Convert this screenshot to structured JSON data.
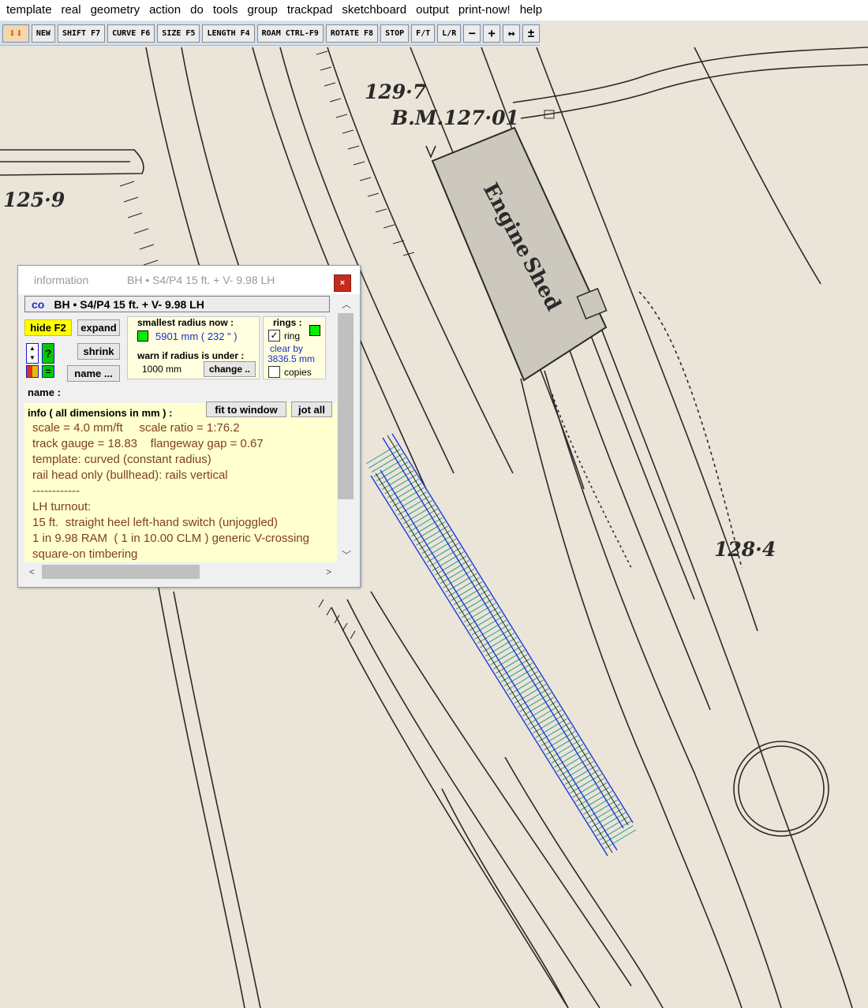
{
  "menu": {
    "items": [
      {
        "label": "template",
        "name": "menu-template"
      },
      {
        "label": "real",
        "name": "menu-real"
      },
      {
        "label": "geometry",
        "name": "menu-geometry"
      },
      {
        "label": "action",
        "name": "menu-action"
      },
      {
        "label": "do",
        "name": "menu-do"
      },
      {
        "label": "tools",
        "name": "menu-tools"
      },
      {
        "label": "group",
        "name": "menu-group"
      },
      {
        "label": "trackpad",
        "name": "menu-trackpad"
      },
      {
        "label": "sketchboard",
        "name": "menu-sketchboard"
      },
      {
        "label": "output",
        "name": "menu-output"
      },
      {
        "label": "print-now!",
        "name": "menu-print-now"
      },
      {
        "label": "help",
        "name": "menu-help"
      }
    ]
  },
  "toolbar": {
    "new": "NEW",
    "shift": "SHIFT F7",
    "curve": "CURVE F6",
    "size": "SIZE F5",
    "length": "LENGTH F4",
    "roam": "ROAM CTRL-F9",
    "rotate": "ROTATE F8",
    "stop": "STOP",
    "ft": "F/T",
    "lr": "L/R",
    "minus": "−",
    "plus": "+",
    "fit_icon": "↔",
    "extra_icon": "±"
  },
  "map": {
    "labels": {
      "spot1": "129·7",
      "bm": "B.M.127·01",
      "spot2": "125·9",
      "spot3": "128·4",
      "shed_line1": "Engine",
      "shed_line2": "Shed"
    }
  },
  "info": {
    "title_main": "information",
    "title_sub": "BH • S4/P4  15 ft.  +  V- 9.98  LH",
    "close": "×",
    "header_code": "co",
    "header_text": "BH • S4/P4  15 ft.  +  V- 9.98  LH",
    "hide_btn": "hide  F2",
    "expand_btn": "expand",
    "shrink_btn": "shrink",
    "name_btn": "name ...",
    "smallest_radius_label": "smallest  radius  now :",
    "smallest_radius_value": "5901 mm ( 232 \" )",
    "warn_label": "warn  if  radius  is  under :",
    "warn_value": "1000 mm",
    "change_btn": "change ..",
    "rings_label": "rings :",
    "ring_label": "ring",
    "ring_checked": "✓",
    "clear_by_label": "clear  by",
    "clear_by_value": "3836.5 mm",
    "copies_label": "copies",
    "name_label": "name :",
    "info_head": "info ( all  dimensions  in  mm ) :",
    "fit_btn": "fit  to  window",
    "jot_btn": "jot  all",
    "lines": [
      "scale = 4.0 mm/ft     scale ratio = 1:76.2",
      "track gauge = 18.83    flangeway gap = 0.67",
      "template: curved (constant radius)",
      "rail head only (bullhead): rails vertical",
      "------------",
      "LH turnout:",
      "15 ft.  straight heel left-hand switch (unjoggled)",
      "1 in 9.98 RAM  ( 1 in 10.00 CLM ) generic V-crossing",
      "square-on timbering"
    ]
  },
  "colors": {
    "map_bg": "#ebe4d8",
    "ink": "#2a2a2a",
    "track_blue": "#1a3ad8",
    "track_teal": "#2a9a8a",
    "toolbar_bg": "#cfe0f3",
    "info_text": "#804020",
    "info_bg": "#ffffd0"
  }
}
